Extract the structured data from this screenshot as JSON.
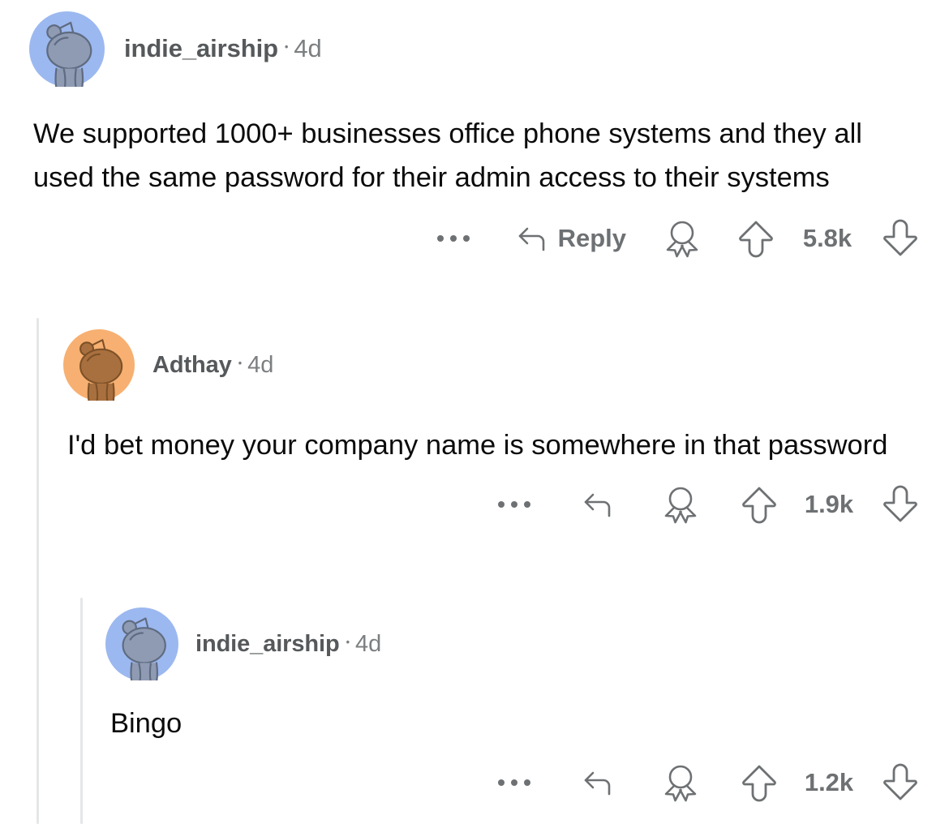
{
  "app": {
    "name": "reddit-comment-thread",
    "background_color": "#ffffff",
    "text_color": "#0b0b0b",
    "muted_color": "#6e7173",
    "thread_line_color": "#e4e6e7"
  },
  "icons": {
    "overflow": "more-horizontal-icon",
    "reply": "reply-arrow-icon",
    "award": "award-ribbon-icon",
    "upvote": "upvote-arrow-icon",
    "downvote": "downvote-arrow-icon",
    "avatar": "reddit-snoo-avatar-icon"
  },
  "comments": [
    {
      "id": "comment-0",
      "depth": 0,
      "username": "indie_airship",
      "separator": "•",
      "timestamp": "4d",
      "body": "We supported 1000+ businesses office phone systems and they all used the same password for their admin access to their systems",
      "avatar": {
        "background_color": "#9cb8f0",
        "body_color": "#8f9bb3",
        "outline_color": "#5f6b80"
      },
      "actions": {
        "overflow_label": "•••",
        "reply_label": "Reply",
        "show_reply_label": true,
        "award_label": "Award",
        "upvote_label": "Upvote",
        "downvote_label": "Downvote",
        "vote_count": "5.8k"
      }
    },
    {
      "id": "comment-1",
      "depth": 1,
      "username": "Adthay",
      "separator": "•",
      "timestamp": "4d",
      "body": "I'd bet money your company name is somewhere in that password",
      "avatar": {
        "background_color": "#f7b071",
        "body_color": "#a9703f",
        "outline_color": "#7d5128"
      },
      "actions": {
        "overflow_label": "•••",
        "reply_label": "",
        "show_reply_label": false,
        "award_label": "Award",
        "upvote_label": "Upvote",
        "downvote_label": "Downvote",
        "vote_count": "1.9k"
      }
    },
    {
      "id": "comment-2",
      "depth": 2,
      "username": "indie_airship",
      "separator": "•",
      "timestamp": "4d",
      "body": "Bingo",
      "avatar": {
        "background_color": "#9cb8f0",
        "body_color": "#8f9bb3",
        "outline_color": "#5f6b80"
      },
      "actions": {
        "overflow_label": "•••",
        "reply_label": "",
        "show_reply_label": false,
        "award_label": "Award",
        "upvote_label": "Upvote",
        "downvote_label": "Downvote",
        "vote_count": "1.2k"
      }
    }
  ]
}
